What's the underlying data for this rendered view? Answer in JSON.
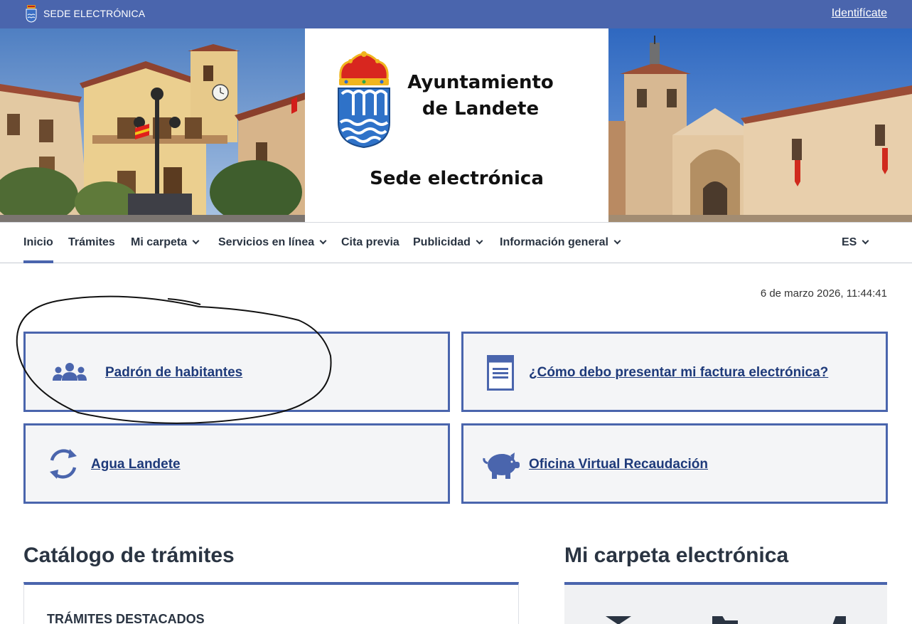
{
  "topbar": {
    "sede_label": "SEDE ELECTRÓNICA",
    "login_link": "Identifícate"
  },
  "hero": {
    "title_line1": "Ayuntamiento",
    "title_line2": "de Landete",
    "subtitle": "Sede electrónica"
  },
  "nav": {
    "items": [
      {
        "label": "Inicio",
        "active": true
      },
      {
        "label": "Trámites"
      },
      {
        "label": "Mi carpeta",
        "dropdown": true
      },
      {
        "label": "Servicios en línea",
        "dropdown": true
      },
      {
        "label": "Cita previa"
      },
      {
        "label": "Publicidad",
        "dropdown": true
      },
      {
        "label": "Información general",
        "dropdown": true
      }
    ],
    "language": "ES"
  },
  "datetime": "6 de marzo 2026, 11:44:41",
  "cards": [
    {
      "label": "Padrón de habitantes",
      "icon": "people-group-icon"
    },
    {
      "label": "¿Cómo debo presentar mi factura electrónica?",
      "icon": "document-icon"
    },
    {
      "label": "Agua Landete",
      "icon": "refresh-icon"
    },
    {
      "label": "Oficina Virtual Recaudación",
      "icon": "piggy-bank-icon"
    }
  ],
  "catalog": {
    "title": "Catálogo de trámites",
    "featured": "TRÁMITES DESTACADOS"
  },
  "folder": {
    "title": "Mi carpeta electrónica"
  },
  "colors": {
    "brand": "#4a65ad",
    "link": "#1e3a7a",
    "text": "#2a3442"
  }
}
